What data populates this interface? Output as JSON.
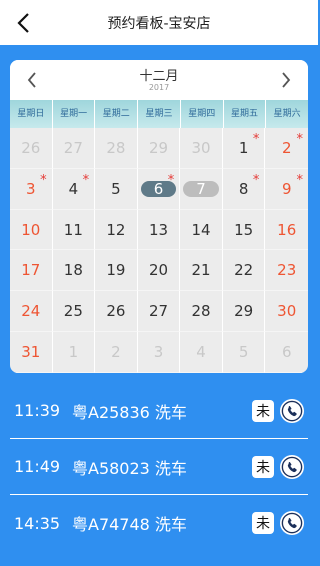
{
  "header": {
    "title": "预约看板-宝安店"
  },
  "calendar": {
    "month": "十二月",
    "year": "2017",
    "weekdays": [
      "星期日",
      "星期一",
      "星期二",
      "星期三",
      "星期四",
      "星期五",
      "星期六"
    ],
    "days": [
      {
        "n": "26",
        "other": true
      },
      {
        "n": "27",
        "other": true
      },
      {
        "n": "28",
        "other": true
      },
      {
        "n": "29",
        "other": true
      },
      {
        "n": "30",
        "other": true
      },
      {
        "n": "1",
        "star": true
      },
      {
        "n": "2",
        "star": true
      },
      {
        "n": "3",
        "star": true
      },
      {
        "n": "4",
        "star": true
      },
      {
        "n": "5"
      },
      {
        "n": "6",
        "star": true,
        "selected": true
      },
      {
        "n": "7",
        "today": true
      },
      {
        "n": "8",
        "star": true
      },
      {
        "n": "9",
        "star": true
      },
      {
        "n": "10"
      },
      {
        "n": "11"
      },
      {
        "n": "12"
      },
      {
        "n": "13"
      },
      {
        "n": "14"
      },
      {
        "n": "15"
      },
      {
        "n": "16"
      },
      {
        "n": "17"
      },
      {
        "n": "18"
      },
      {
        "n": "19"
      },
      {
        "n": "20"
      },
      {
        "n": "21"
      },
      {
        "n": "22"
      },
      {
        "n": "23"
      },
      {
        "n": "24"
      },
      {
        "n": "25"
      },
      {
        "n": "26"
      },
      {
        "n": "27"
      },
      {
        "n": "28"
      },
      {
        "n": "29"
      },
      {
        "n": "30"
      },
      {
        "n": "31"
      },
      {
        "n": "1",
        "other": true
      },
      {
        "n": "2",
        "other": true
      },
      {
        "n": "3",
        "other": true
      },
      {
        "n": "4",
        "other": true
      },
      {
        "n": "5",
        "other": true
      },
      {
        "n": "6",
        "other": true
      }
    ]
  },
  "appointments": [
    {
      "time": "11:39",
      "desc": "粤A25836 洗车",
      "status": "未"
    },
    {
      "time": "11:49",
      "desc": "粤A58023 洗车",
      "status": "未"
    },
    {
      "time": "14:35",
      "desc": "粤A74748 洗车",
      "status": "未"
    }
  ],
  "colors": {
    "background": "#2f8ff0",
    "weekend": "#ee5533",
    "star": "#e53935",
    "selected": "#5f7a88",
    "today": "#bdbdbd"
  },
  "icons": {
    "back": "chevron-left-icon",
    "prev": "chevron-left-icon",
    "next": "chevron-right-icon",
    "phone": "phone-icon"
  }
}
